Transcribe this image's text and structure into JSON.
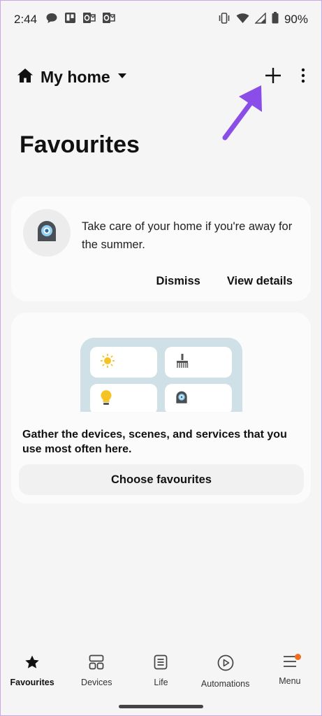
{
  "status_bar": {
    "time": "2:44",
    "battery": "90%",
    "left_icons": [
      "chat-bubble-icon",
      "trello-icon",
      "outlook-icon",
      "outlook-icon"
    ],
    "right_icons": [
      "vibrate-icon",
      "wifi-icon",
      "signal-icon",
      "battery-icon"
    ]
  },
  "header": {
    "home_name": "My home",
    "home_icon": "house-icon",
    "dropdown_icon": "caret-down-icon",
    "add_icon": "plus-icon",
    "more_icon": "more-vertical-icon"
  },
  "page": {
    "title": "Favourites"
  },
  "promo_card": {
    "icon": "camera-device-icon",
    "message": "Take care of your home if you're away for the summer.",
    "dismiss_label": "Dismiss",
    "details_label": "View details"
  },
  "favourites_card": {
    "illustration_tiles": [
      "sun-icon",
      "brush-icon",
      "bulb-icon",
      "camera-device-icon"
    ],
    "description": "Gather the devices, scenes, and services that you use most often here.",
    "button_label": "Choose favourites"
  },
  "bottom_nav": {
    "items": [
      {
        "label": "Favourites",
        "icon": "star-icon",
        "active": true
      },
      {
        "label": "Devices",
        "icon": "devices-grid-icon",
        "active": false
      },
      {
        "label": "Life",
        "icon": "life-list-icon",
        "active": false
      },
      {
        "label": "Automations",
        "icon": "play-circle-icon",
        "active": false
      },
      {
        "label": "Menu",
        "icon": "hamburger-menu-icon",
        "active": false,
        "badge": true
      }
    ]
  },
  "colors": {
    "background": "#f5f5f5",
    "card": "#fbfbfb",
    "annotation_arrow": "#8a4de8",
    "badge": "#f36f1f",
    "illustration": "#cfe0e6"
  }
}
